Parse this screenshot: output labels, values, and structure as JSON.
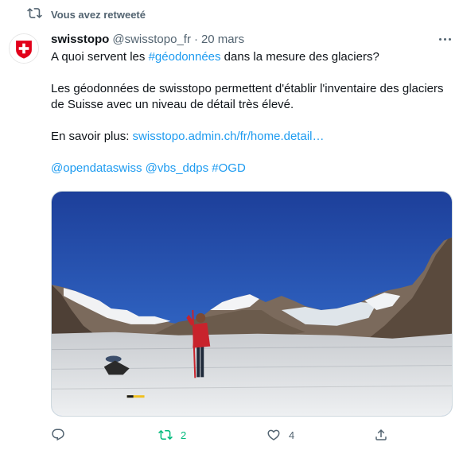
{
  "retweet": {
    "icon": "retweet-icon",
    "text": "Vous avez retweeté"
  },
  "author": {
    "avatar_icon": "swiss-cross-shield-icon",
    "name": "swisstopo",
    "handle": "@swisstopo_fr",
    "separator": "·",
    "date": "20 mars"
  },
  "tweet": {
    "line1_before": "A quoi servent les ",
    "line1_hashtag": "#géodonnées",
    "line1_after": " dans la mesure des glaciers?",
    "para2": "Les géodonnées de swisstopo permettent d'établir l'inventaire des glaciers de Suisse avec un niveau de détail très élevé.",
    "more_label": "En savoir plus: ",
    "more_link": "swisstopo.admin.ch/fr/home.detail…",
    "mention1": "@opendataswiss",
    "mention2": "@vbs_ddps",
    "hashtag2": "#OGD"
  },
  "actions": {
    "reply": {
      "icon": "reply-icon",
      "count": ""
    },
    "retweet": {
      "icon": "retweet-icon",
      "count": "2"
    },
    "like": {
      "icon": "heart-icon",
      "count": "4"
    },
    "share": {
      "icon": "share-icon"
    }
  },
  "colors": {
    "link": "#1d9bf0",
    "retweet_active": "#00ba7c",
    "secondary_text": "#536471",
    "swiss_red": "#e2001a"
  }
}
